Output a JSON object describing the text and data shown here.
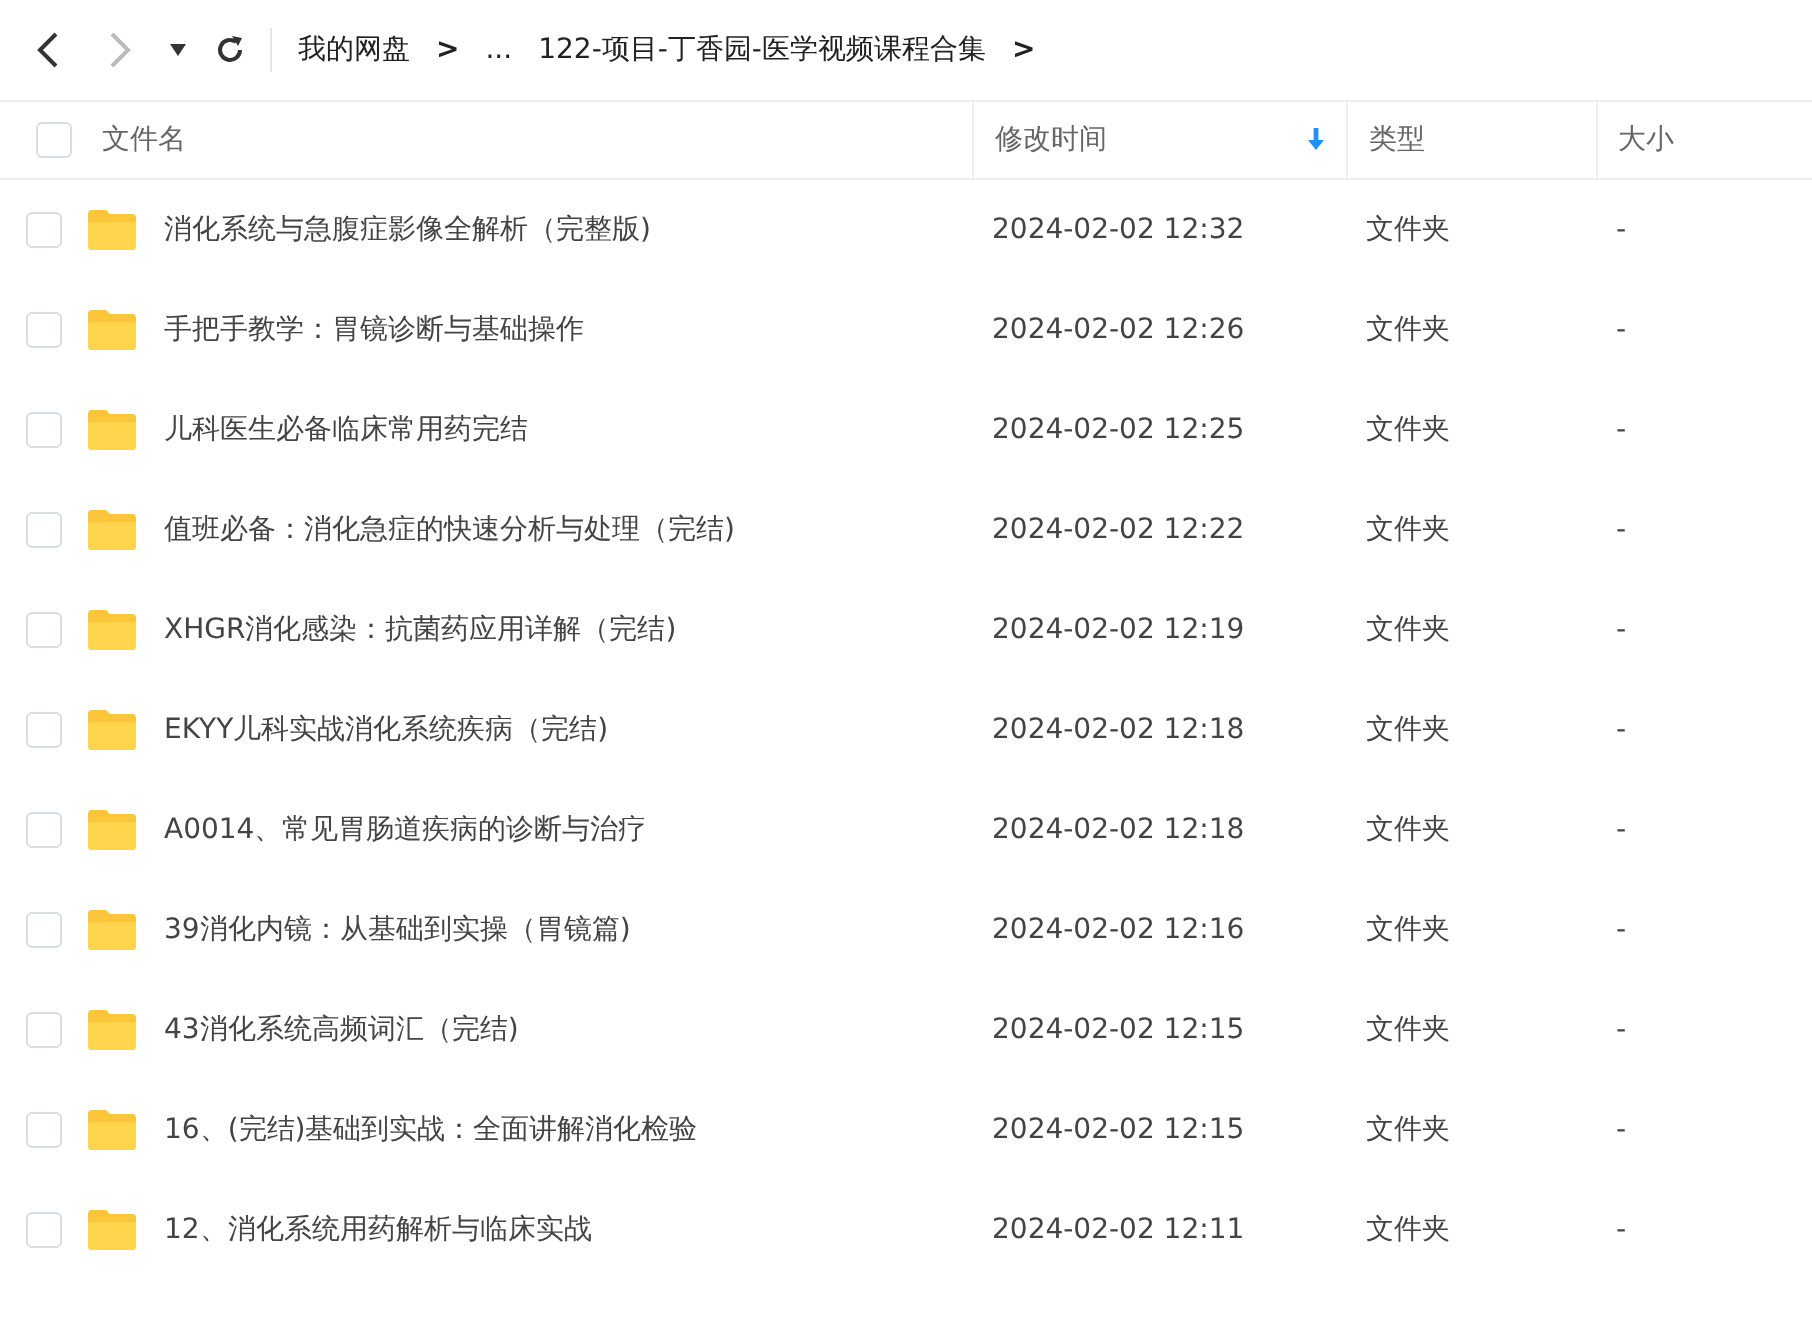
{
  "nav": {
    "back_disabled": false,
    "forward_disabled": true
  },
  "breadcrumb": [
    {
      "kind": "crumb",
      "label": "我的网盘"
    },
    {
      "kind": "sep",
      "label": ">"
    },
    {
      "kind": "crumb",
      "label": "..."
    },
    {
      "kind": "crumb",
      "label": "122-项目-丁香园-医学视频课程合集"
    },
    {
      "kind": "sep",
      "label": ">"
    }
  ],
  "table": {
    "select_all_checked": false,
    "columns": [
      {
        "label": "文件名",
        "sorted": false
      },
      {
        "label": "修改时间",
        "sorted": true
      },
      {
        "label": "类型",
        "sorted": false
      },
      {
        "label": "大小",
        "sorted": false
      }
    ],
    "rows": [
      {
        "name": "消化系统与急腹症影像全解析（完整版)",
        "modified": "2024-02-02 12:32",
        "type": "文件夹",
        "size": "-",
        "checked": false
      },
      {
        "name": "手把手教学：胃镜诊断与基础操作",
        "modified": "2024-02-02 12:26",
        "type": "文件夹",
        "size": "-",
        "checked": false
      },
      {
        "name": "儿科医生必备临床常用药完结",
        "modified": "2024-02-02 12:25",
        "type": "文件夹",
        "size": "-",
        "checked": false
      },
      {
        "name": "值班必备：消化急症的快速分析与处理（完结)",
        "modified": "2024-02-02 12:22",
        "type": "文件夹",
        "size": "-",
        "checked": false
      },
      {
        "name": "XHGR消化感染：抗菌药应用详解（完结)",
        "modified": "2024-02-02 12:19",
        "type": "文件夹",
        "size": "-",
        "checked": false
      },
      {
        "name": "EKYY儿科实战消化系统疾病（完结)",
        "modified": "2024-02-02 12:18",
        "type": "文件夹",
        "size": "-",
        "checked": false
      },
      {
        "name": "A0014、常见胃肠道疾病的诊断与治疗",
        "modified": "2024-02-02 12:18",
        "type": "文件夹",
        "size": "-",
        "checked": false
      },
      {
        "name": "39消化内镜：从基础到实操（胃镜篇)",
        "modified": "2024-02-02 12:16",
        "type": "文件夹",
        "size": "-",
        "checked": false
      },
      {
        "name": "43消化系统高频词汇（完结)",
        "modified": "2024-02-02 12:15",
        "type": "文件夹",
        "size": "-",
        "checked": false
      },
      {
        "name": "16、(完结)基础到实战：全面讲解消化检验",
        "modified": "2024-02-02 12:15",
        "type": "文件夹",
        "size": "-",
        "checked": false
      },
      {
        "name": "12、消化系统用药解析与临床实战",
        "modified": "2024-02-02 12:11",
        "type": "文件夹",
        "size": "-",
        "checked": false
      }
    ]
  }
}
